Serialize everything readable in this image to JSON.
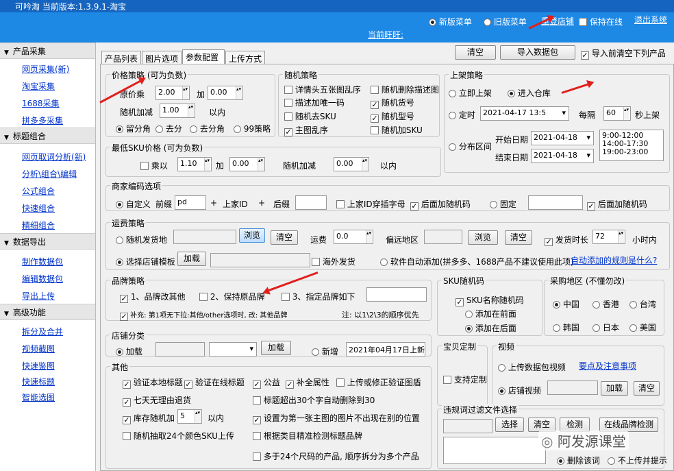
{
  "window": {
    "title": "可吟淘   当前版本:1.3.9.1-淘宝"
  },
  "topbar": {
    "menu_new": "新版菜单",
    "menu_old": "旧版菜单",
    "relogin": "重登店铺",
    "keep_online": "保持在线",
    "logout": "退出系统",
    "current_user": "当前旺旺:"
  },
  "sidebar": {
    "sections": [
      {
        "title": "产品采集",
        "items": [
          "网页采集(新)",
          "淘宝采集",
          "1688采集",
          "拼多多采集"
        ]
      },
      {
        "title": "标题组合",
        "items": [
          "网页取词分析(新)",
          "分析\\组合\\编辑",
          "公式组合",
          "快速组合",
          "精细组合"
        ]
      },
      {
        "title": "数据导出",
        "items": [
          "制作数据包",
          "编辑数据包",
          "导出上传"
        ]
      },
      {
        "title": "高级功能",
        "items": [
          "拆分及合并",
          "视频截图",
          "快速鉴图",
          "快速标题",
          "智能选图"
        ]
      }
    ]
  },
  "tabs": [
    "产品列表",
    "图片选项",
    "参数配置",
    "上传方式"
  ],
  "toolbar": {
    "clear": "清空",
    "import": "导入数据包",
    "clear_before_import": "导入前清空下列产品"
  },
  "price": {
    "title": "价格策略 (可为负数)",
    "multiply_label": "原价乘",
    "multiply": "2.00",
    "add_label": "加",
    "add": "0.00",
    "random_label": "随机加减",
    "random": "1.00",
    "within": "以内",
    "r1": "留分角",
    "r2": "去分",
    "r3": "去分角",
    "r4": "99策略"
  },
  "minsku": {
    "title": "最低SKU价格 (可为负数)",
    "multiply_label": "乘以",
    "multiply": "1.10",
    "add_label": "加",
    "add": "0.00",
    "random_label": "随机加减",
    "random": "0.00",
    "within": "以内"
  },
  "random_strategy": {
    "title": "随机策略",
    "items": [
      "详情头五张图乱序",
      "随机删除描述图",
      "描述加唯一码",
      "随机货号",
      "随机去SKU",
      "随机型号",
      "主图乱序",
      "随机加SKU"
    ]
  },
  "listing": {
    "title": "上架策略",
    "immediate": "立即上架",
    "warehouse": "进入仓库",
    "timed": "定时",
    "timed_value": "2021-04-17 13:5",
    "every": "每隔",
    "every_value": "60",
    "seconds": "秒上架",
    "interval": "分布区间",
    "start_label": "开始日期",
    "start": "2021-04-18",
    "end_label": "结束日期",
    "end": "2021-04-18",
    "times": [
      "9:00-12:00",
      "14:00-17:30",
      "19:00-23:00"
    ]
  },
  "merchant_code": {
    "title": "商家编码选项",
    "custom": "自定义",
    "prefix_label": "前缀",
    "prefix": "pd",
    "plus": "+",
    "seller_id": "上家ID",
    "suffix_label": "后缀",
    "seller_id_str": "上家ID穿插字母",
    "suffix_random": "后面加随机码",
    "fixed": "固定",
    "fixed_random": "后面加随机码"
  },
  "shipping": {
    "title": "运费策略",
    "random_origin": "随机发货地",
    "browse": "浏览",
    "clear": "清空",
    "fee_label": "运费",
    "fee": "0.0",
    "remote": "偏远地区",
    "browse2": "浏览",
    "clear2": "清空",
    "ship_time": "发货时长",
    "ship_time_value": "72",
    "hours": "小时内",
    "store_template": "选择店铺模板",
    "load": "加载",
    "overseas": "海外发货",
    "auto_add": "软件自动添加(拼多多、1688产品不建议使用此项)",
    "auto_rule_link": "自动添加的规则是什么?"
  },
  "brand": {
    "title": "品牌策略",
    "b1": "1、品牌改其他",
    "b2": "2、保持原品牌",
    "b3": "3、指定品牌如下",
    "note": "补充: 第1项无下拉:其他/other选项时, 改: 其他品牌",
    "order": "注: 以1\\2\\3的顺序优先"
  },
  "sku_random": {
    "title": "SKU随机码",
    "name_random": "SKU名称随机码",
    "front": "添加在前面",
    "back": "添加在后面"
  },
  "purchase_region": {
    "title": "采购地区 (不懂勿改)",
    "regions": [
      "中国",
      "香港",
      "台湾",
      "韩国",
      "日本",
      "美国"
    ]
  },
  "store_category": {
    "title": "店铺分类",
    "load": "加载",
    "load_btn": "加载",
    "new": "新增",
    "new_value": "2021年04月17日上新"
  },
  "custom_item": {
    "title": "宝贝定制",
    "support": "支持定制"
  },
  "video": {
    "title": "视频",
    "upload_video": "上传数据包视频",
    "notes_link": "要点及注意事项",
    "store_video": "店铺视频",
    "load": "加载",
    "clear": "清空"
  },
  "other": {
    "title": "其他",
    "items": [
      "验证本地标题",
      "验证在线标题",
      "公益",
      "补全属性",
      "上传或修正验证图盾",
      "七天无理由退货",
      "标题超出30个字自动删除到30",
      "库存随机加",
      "以内",
      "设置为第一张主图的图片不出现在别的位置",
      "随机抽取24个颜色SKU上传",
      "根据类目精准检测标题品牌",
      "多于24个尺码的产品, 顺序拆分为多个产品"
    ],
    "stock_value": "5"
  },
  "violation": {
    "title": "违规词过滤文件选择",
    "select": "选择",
    "clear": "清空",
    "check": "检测",
    "online_brand": "在线品牌检测",
    "delete_word": "删除该词",
    "no_upload": "不上传并提示"
  },
  "watermark": {
    "text": "阿发源课堂"
  }
}
